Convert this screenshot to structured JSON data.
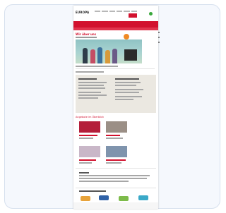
{
  "site": {
    "logo_text": "EUROPA",
    "section_heading": "Angebote im Überblick",
    "hero_title": "Wir über uns"
  },
  "colors": {
    "brand": "#d2112e",
    "accent_green": "#3aa83c",
    "accent_orange": "#f08a24",
    "beige_panel": "#ebe8e1",
    "frame_background": "#f5f8fd"
  },
  "icons": [
    "menu-icon",
    "search-icon",
    "share-icon"
  ]
}
